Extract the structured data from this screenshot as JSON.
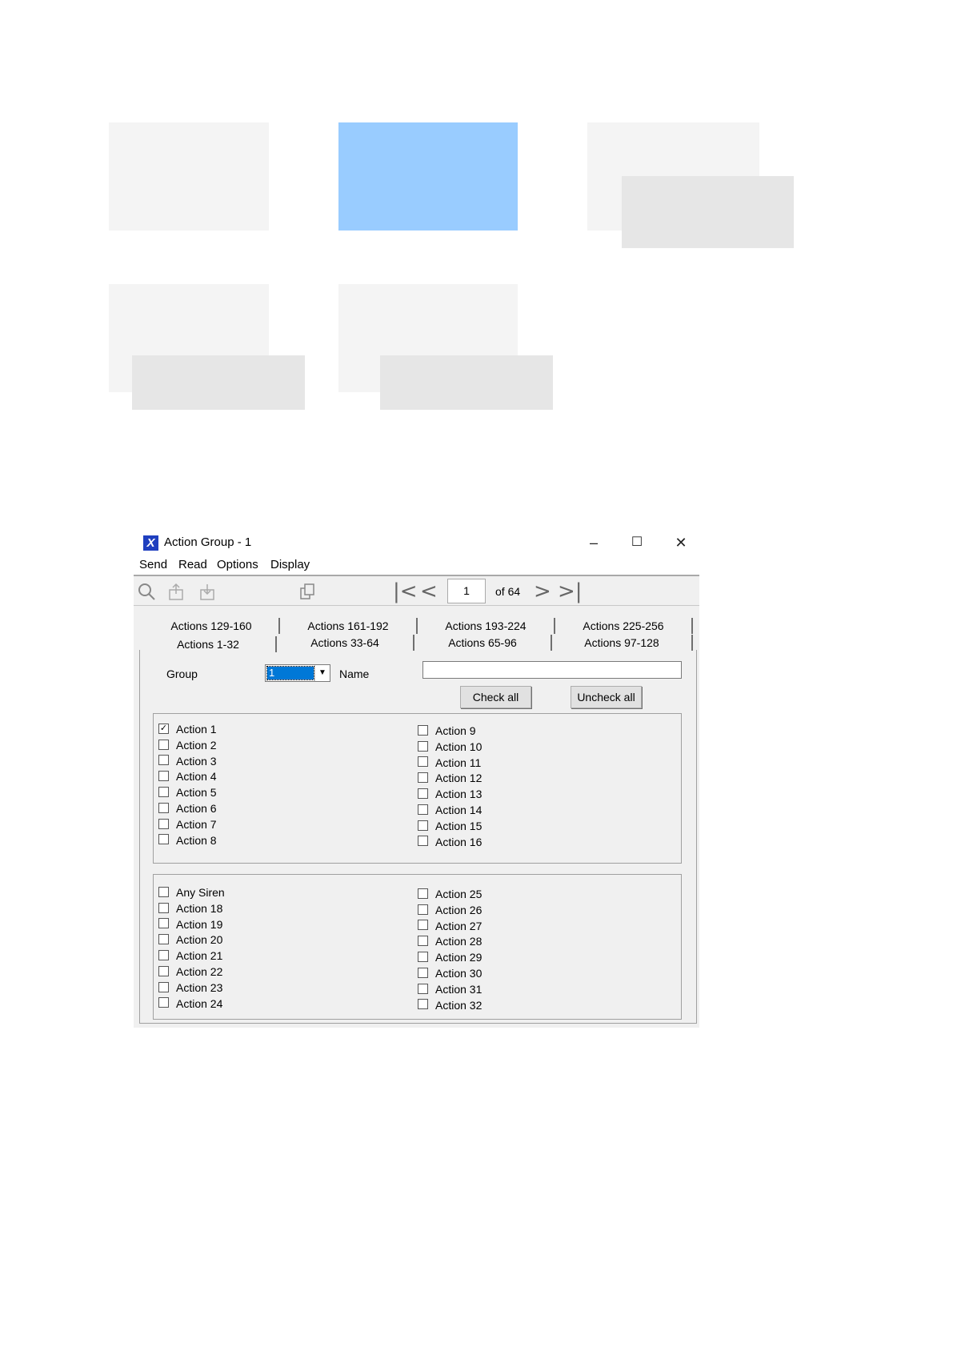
{
  "window": {
    "title": "Action Group - 1",
    "icon_letter": "X",
    "minimize_symbol": "–",
    "maximize_symbol": "☐",
    "close_symbol": "✕"
  },
  "menu": [
    "Send",
    "Read",
    "Options",
    "Display"
  ],
  "toolbar": {
    "icons": [
      "search-icon",
      "upload-icon",
      "download-icon",
      "copy-icon"
    ],
    "first_symbol": "|<",
    "prev_symbol": "<",
    "next_symbol": ">",
    "last_symbol": ">|",
    "page": "1",
    "of_label": "of 64"
  },
  "tabs_row1": [
    "Actions 129-160",
    "Actions 161-192",
    "Actions 193-224",
    "Actions 225-256"
  ],
  "tabs_row2": [
    "Actions 1-32",
    "Actions 33-64",
    "Actions 65-96",
    "Actions 97-128"
  ],
  "form": {
    "group_label": "Group",
    "group_value": "1",
    "name_label": "Name",
    "name_value": "",
    "check_all": "Check all",
    "uncheck_all": "Uncheck all"
  },
  "group1_left": [
    {
      "label": "Action 1",
      "checked": true
    },
    {
      "label": "Action 2",
      "checked": false
    },
    {
      "label": "Action 3",
      "checked": false
    },
    {
      "label": "Action 4",
      "checked": false
    },
    {
      "label": "Action 5",
      "checked": false
    },
    {
      "label": "Action 6",
      "checked": false
    },
    {
      "label": "Action 7",
      "checked": false
    },
    {
      "label": "Action 8",
      "checked": false
    }
  ],
  "group1_right": [
    {
      "label": "Action 9",
      "checked": false
    },
    {
      "label": "Action 10",
      "checked": false
    },
    {
      "label": "Action 11",
      "checked": false
    },
    {
      "label": "Action 12",
      "checked": false
    },
    {
      "label": "Action 13",
      "checked": false
    },
    {
      "label": "Action 14",
      "checked": false
    },
    {
      "label": "Action 15",
      "checked": false
    },
    {
      "label": "Action 16",
      "checked": false
    }
  ],
  "group2_left": [
    {
      "label": "Any Siren",
      "checked": false
    },
    {
      "label": "Action 18",
      "checked": false
    },
    {
      "label": "Action 19",
      "checked": false
    },
    {
      "label": "Action 20",
      "checked": false
    },
    {
      "label": "Action 21",
      "checked": false
    },
    {
      "label": "Action 22",
      "checked": false
    },
    {
      "label": "Action 23",
      "checked": false
    },
    {
      "label": "Action 24",
      "checked": false
    }
  ],
  "group2_right": [
    {
      "label": "Action 25",
      "checked": false
    },
    {
      "label": "Action 26",
      "checked": false
    },
    {
      "label": "Action 27",
      "checked": false
    },
    {
      "label": "Action 28",
      "checked": false
    },
    {
      "label": "Action 29",
      "checked": false
    },
    {
      "label": "Action 30",
      "checked": false
    },
    {
      "label": "Action 31",
      "checked": false
    },
    {
      "label": "Action 32",
      "checked": false
    }
  ],
  "colors": {
    "highlight_block": "#99ccff",
    "placeholder_light": "#f4f4f4",
    "placeholder_mid": "#e6e6e6",
    "selection": "#0078d7"
  }
}
